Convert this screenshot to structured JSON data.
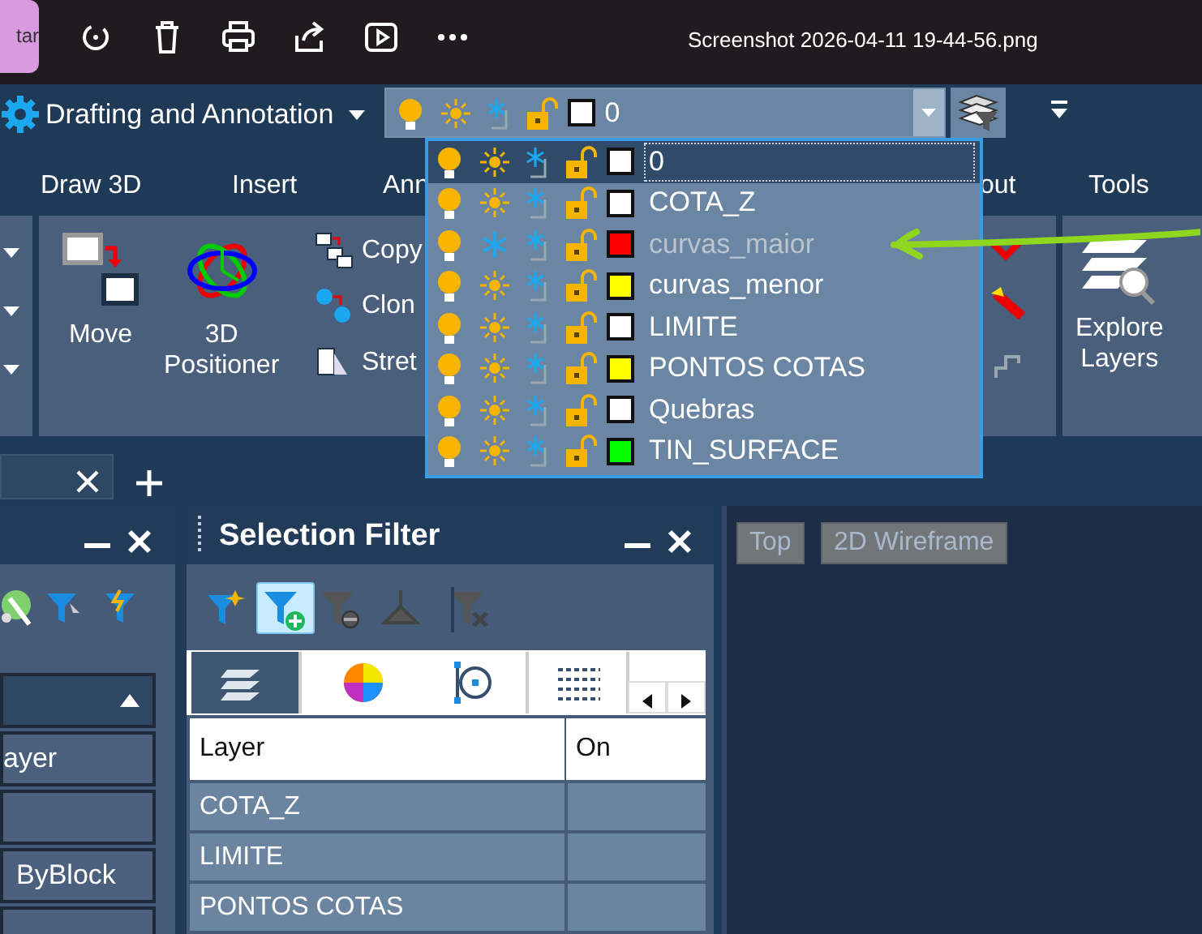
{
  "app_bar": {
    "left_button": "tar",
    "title": "Screenshot 2026-04-11 19-44-56.png"
  },
  "workspace": {
    "label": "Drafting and Annotation"
  },
  "layer_combo": {
    "value": "0",
    "color": "#ffffff"
  },
  "layer_list": [
    {
      "name": "0",
      "color": "#ffffff",
      "frozen": false,
      "selected": true
    },
    {
      "name": "COTA_Z",
      "color": "#ffffff",
      "frozen": false,
      "selected": false
    },
    {
      "name": "curvas_maior",
      "color": "#ff0000",
      "frozen": true,
      "selected": false
    },
    {
      "name": "curvas_menor",
      "color": "#ffff00",
      "frozen": false,
      "selected": false
    },
    {
      "name": "LIMITE",
      "color": "#ffffff",
      "frozen": false,
      "selected": false
    },
    {
      "name": "PONTOS COTAS",
      "color": "#ffff00",
      "frozen": false,
      "selected": false
    },
    {
      "name": "Quebras",
      "color": "#ffffff",
      "frozen": false,
      "selected": false
    },
    {
      "name": "TIN_SURFACE",
      "color": "#00ff00",
      "frozen": false,
      "selected": false
    }
  ],
  "ribbon_tabs": [
    "Draw 3D",
    "Insert",
    "Ann",
    "out",
    "Tools"
  ],
  "ribbon": {
    "large_tools": [
      {
        "kind": "move",
        "label": "Move"
      },
      {
        "kind": "positioner",
        "label": "3D\nPositioner"
      }
    ],
    "small_tools": [
      {
        "kind": "copy",
        "label": "Copy"
      },
      {
        "kind": "clone",
        "label": "Clon"
      },
      {
        "kind": "stretch",
        "label": "Stret"
      }
    ],
    "explore": "Explore\nLayers"
  },
  "properties_panel": {
    "rows": [
      {
        "kind": "text",
        "text": "ayer"
      },
      {
        "kind": "blank"
      },
      {
        "kind": "text",
        "text": "ByBlock"
      },
      {
        "kind": "blank"
      }
    ]
  },
  "selection_filter": {
    "title": "Selection Filter",
    "toolbar": [
      {
        "kind": "new",
        "pressed": false
      },
      {
        "kind": "add",
        "pressed": true
      },
      {
        "kind": "remove",
        "pressed": false
      },
      {
        "kind": "intersect",
        "pressed": false
      },
      {
        "kind": "clear",
        "pressed": false
      }
    ],
    "tabs": [
      {
        "kind": "layers",
        "selected": true
      },
      {
        "kind": "color",
        "selected": false
      },
      {
        "kind": "circle",
        "selected": false
      },
      {
        "kind": "linetype",
        "selected": false
      }
    ],
    "columns": [
      "Layer",
      "On"
    ],
    "rows": [
      "COTA_Z",
      "LIMITE",
      "PONTOS COTAS"
    ]
  },
  "viewport": {
    "labels": [
      "Top",
      "2D Wireframe"
    ]
  }
}
